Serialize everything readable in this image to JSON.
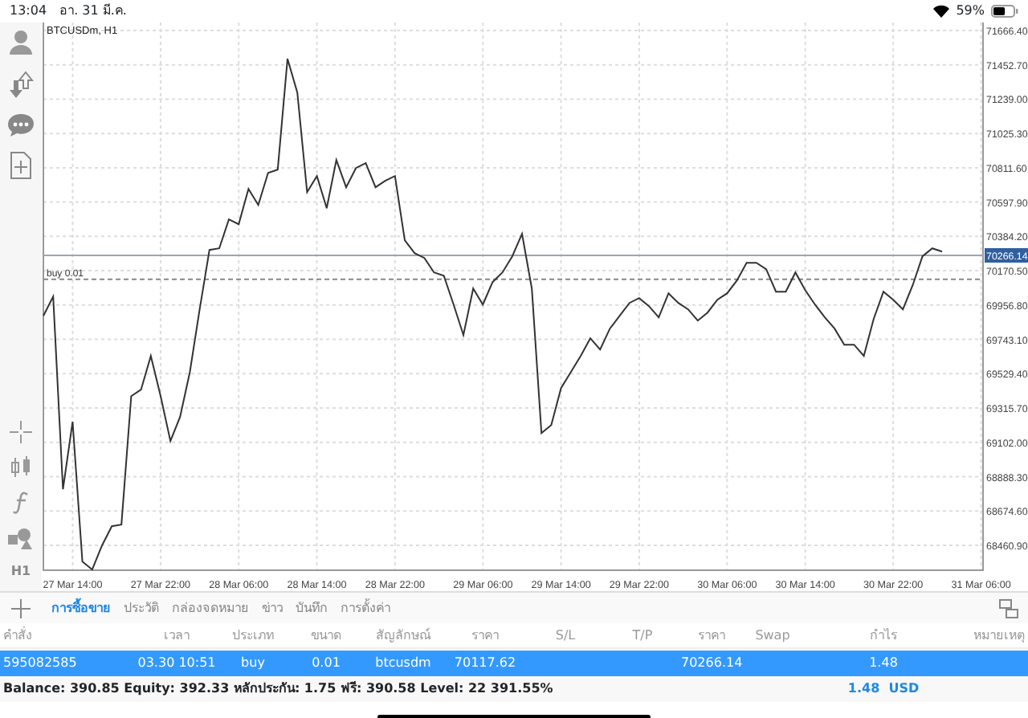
{
  "status_bar": {
    "time": "13:04",
    "date": "อา. 31 มี.ค.",
    "battery": "59%"
  },
  "toolbar": {
    "timeframe": "H1"
  },
  "chart": {
    "title": "BTCUSDm, H1",
    "chart_data": {
      "type": "line",
      "grid": true,
      "ylim": [
        68306,
        71716
      ],
      "ref_lines": [
        {
          "axis": "y",
          "value": 70266.14,
          "label": "70266.14",
          "color": "#9aa6b8"
        },
        {
          "axis": "y",
          "value": 70117.62,
          "label": "buy 0.01",
          "color": "#888888"
        }
      ],
      "yticks": [
        {
          "value": 71666.4,
          "label": "71666.40"
        },
        {
          "value": 71452.7,
          "label": "71452.70"
        },
        {
          "value": 71239,
          "label": "71239.00"
        },
        {
          "value": 71025.3,
          "label": "71025.30"
        },
        {
          "value": 70811.6,
          "label": "70811.60"
        },
        {
          "value": 70597.9,
          "label": "70597.90"
        },
        {
          "value": 70384.2,
          "label": "70384.20"
        },
        {
          "value": 70170.5,
          "label": "70170.50"
        },
        {
          "value": 69956.8,
          "label": "69956.80"
        },
        {
          "value": 69743.1,
          "label": "69743.10"
        },
        {
          "value": 69529.4,
          "label": "69529.40"
        },
        {
          "value": 69315.7,
          "label": "69315.70"
        },
        {
          "value": 69102,
          "label": "69102.00"
        },
        {
          "value": 68888.3,
          "label": "68888.30"
        },
        {
          "value": 68674.6,
          "label": "68674.60"
        },
        {
          "value": 68460.9,
          "label": "68460.90"
        }
      ],
      "categories": [
        null,
        null,
        null,
        "27 Mar 14:00",
        null,
        null,
        null,
        null,
        null,
        null,
        null,
        null,
        "27 Mar 22:00",
        null,
        null,
        null,
        null,
        null,
        null,
        null,
        "28 Mar 06:00",
        null,
        null,
        null,
        null,
        null,
        null,
        null,
        "28 Mar 14:00",
        null,
        null,
        null,
        null,
        null,
        null,
        null,
        "28 Mar 22:00",
        null,
        null,
        null,
        null,
        null,
        null,
        null,
        null,
        "29 Mar 06:00",
        null,
        null,
        null,
        null,
        null,
        null,
        null,
        "29 Mar 14:00",
        null,
        null,
        null,
        null,
        null,
        null,
        null,
        "29 Mar 22:00",
        null,
        null,
        null,
        null,
        null,
        null,
        null,
        null,
        "30 Mar 06:00",
        null,
        null,
        null,
        null,
        null,
        null,
        null,
        "30 Mar 14:00",
        null,
        null,
        null,
        null,
        null,
        null,
        null,
        null,
        "30 Mar 22:00",
        null,
        null,
        null,
        null,
        null,
        null,
        null,
        null,
        "31 Mar 06:00"
      ],
      "series": [
        {
          "color": "#333333",
          "values": [
            69890,
            70010,
            68810,
            69230,
            68360,
            68310,
            68460,
            68580,
            68590,
            69390,
            69430,
            69640,
            69390,
            69110,
            69260,
            69540,
            69930,
            70300,
            70310,
            70490,
            70460,
            70680,
            70580,
            70780,
            70800,
            71490,
            71280,
            70660,
            70760,
            70560,
            70860,
            70690,
            70810,
            70840,
            70690,
            70730,
            70760,
            70360,
            70280,
            70250,
            70160,
            70140,
            69960,
            69770,
            70060,
            69960,
            70100,
            70160,
            70260,
            70400,
            70060,
            69160,
            69210,
            69440,
            69540,
            69640,
            69750,
            69680,
            69810,
            69890,
            69970,
            70000,
            69950,
            69880,
            70030,
            69970,
            69930,
            69860,
            69910,
            69990,
            70030,
            70110,
            70220,
            70220,
            70180,
            70040,
            70040,
            70160,
            70050,
            69960,
            69880,
            69810,
            69710,
            69710,
            69640,
            69870,
            70040,
            69990,
            69930,
            70080,
            70260,
            70310,
            70290,
            null,
            null,
            null,
            null
          ]
        }
      ]
    }
  },
  "tabs": [
    {
      "label": "การซื้อขาย",
      "selected": true
    },
    {
      "label": "ประวัติ",
      "selected": false
    },
    {
      "label": "กล่องจดหมาย",
      "selected": false
    },
    {
      "label": "ข่าว",
      "selected": false
    },
    {
      "label": "บันทึก",
      "selected": false
    },
    {
      "label": "การตั้งค่า",
      "selected": false
    }
  ],
  "table": {
    "columns": [
      "คำสั่ง",
      "เวลา",
      "ประเภท",
      "ขนาด",
      "สัญลักษณ์",
      "ราคา",
      "S/L",
      "T/P",
      "ราคา",
      "Swap",
      "กำไร",
      "หมายเหตุ"
    ],
    "rows": [
      {
        "selected": true,
        "cells": [
          "595082585",
          "03.30 10:51",
          "buy",
          "0.01",
          "btcusdm",
          "70117.62",
          "",
          "",
          "70266.14",
          "",
          "1.48",
          ""
        ]
      }
    ]
  },
  "summary": {
    "text": "Balance: 390.85 Equity: 392.33 หลักประกัน: 1.75 ฟรี: 390.58 Level: 22 391.55%",
    "profit": "1.48  USD"
  }
}
